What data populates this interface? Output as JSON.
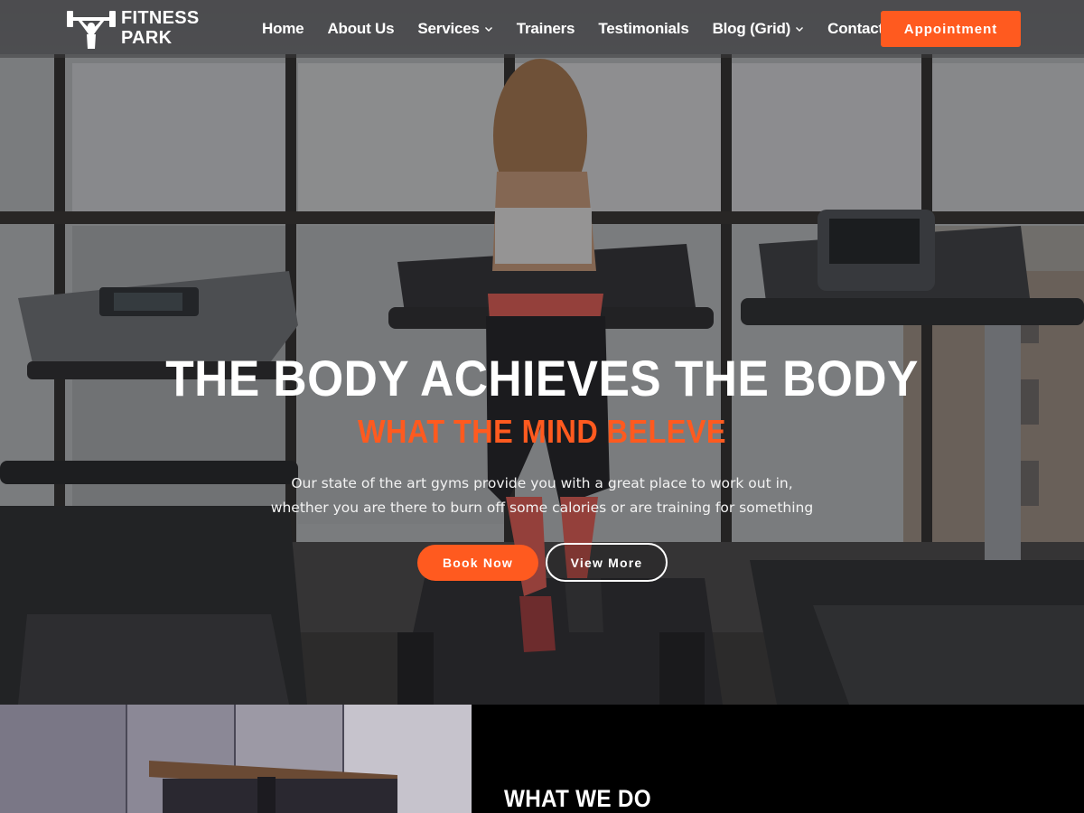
{
  "brand": {
    "line1": "FITNESS",
    "line2": "PARK",
    "logo_icon": "weightlifter-icon"
  },
  "nav": {
    "items": [
      {
        "label": "Home",
        "has_dropdown": false
      },
      {
        "label": "About Us",
        "has_dropdown": false
      },
      {
        "label": "Services",
        "has_dropdown": true
      },
      {
        "label": "Trainers",
        "has_dropdown": false
      },
      {
        "label": "Testimonials",
        "has_dropdown": false
      },
      {
        "label": "Blog (Grid)",
        "has_dropdown": true
      },
      {
        "label": "Contact Us",
        "has_dropdown": false
      }
    ],
    "cta_label": "Appointment"
  },
  "hero": {
    "title": "THE BODY ACHIEVES THE BODY",
    "subtitle": "WHAT THE MIND BELEVE",
    "description_line1": "Our state of the art gyms provide you with a great place to work out in,",
    "description_line2": "whether you are there to burn off some calories or are training for something",
    "primary_button": "Book Now",
    "secondary_button": "View More"
  },
  "section": {
    "heading": "WHAT WE DO"
  },
  "colors": {
    "accent": "#ff5a1f",
    "header_bg": "#3c3c3e",
    "text": "#ffffff",
    "section_bg": "#000000"
  }
}
